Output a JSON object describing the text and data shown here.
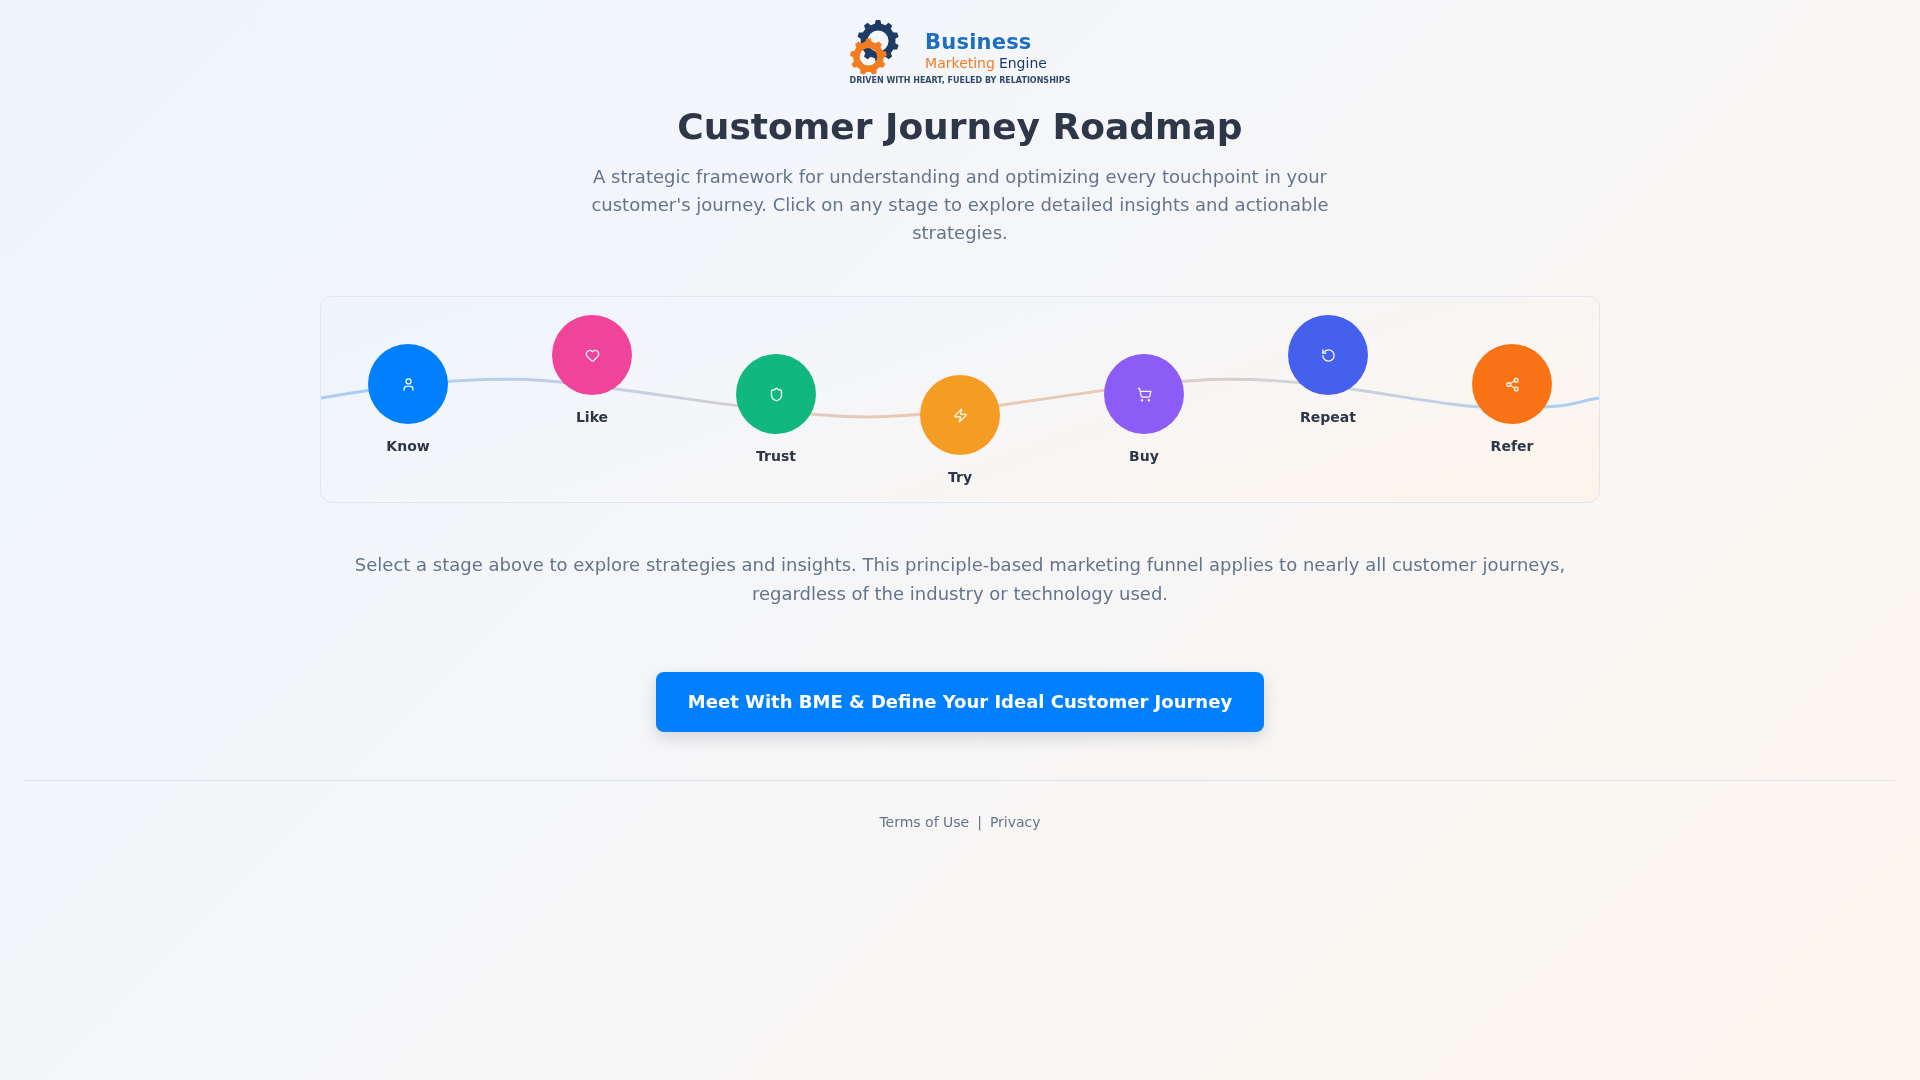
{
  "logo": {
    "name": "Business",
    "subname_1": "Marketing",
    "subname_2": "Engine",
    "tagline": "DRIVEN WITH HEART, FUELED BY RELATIONSHIPS"
  },
  "header": {
    "title": "Customer Journey Roadmap",
    "subtitle": "A strategic framework for understanding and optimizing every touchpoint in your customer's journey. Click on any stage to explore detailed insights and actionable strategies."
  },
  "roadmap": {
    "stages": [
      {
        "label": "Know",
        "color": "#0080ff",
        "selected": false
      },
      {
        "label": "Like",
        "color": "#f0439a",
        "selected": false
      },
      {
        "label": "Trust",
        "color": "#10b77f",
        "selected": false
      },
      {
        "label": "Try",
        "color": "#f59c23",
        "selected": false
      },
      {
        "label": "Buy",
        "color": "#8b5cf6",
        "selected": false
      },
      {
        "label": "Repeat",
        "color": "#4560ec",
        "selected": false
      },
      {
        "label": "Refer",
        "color": "#f97316",
        "selected": false
      }
    ]
  },
  "intro": "Select a stage above to explore strategies and insights. This principle-based marketing funnel applies to nearly all customer journeys, regardless of the industry or technology used.",
  "cta_button": "Meet With BME & Define Your Ideal Customer Journey",
  "footer": {
    "links": [
      {
        "label": "Terms of Use"
      },
      {
        "label": "Privacy"
      }
    ],
    "separator": "|"
  }
}
